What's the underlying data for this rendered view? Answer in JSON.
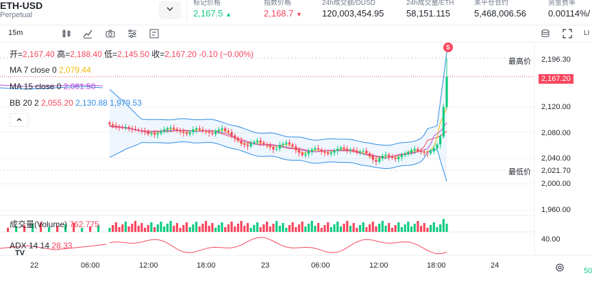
{
  "header": {
    "symbol": "ETH-USD",
    "subtitle": "Perpetual",
    "stats": [
      {
        "label": "标记价格",
        "value": "2,167.5",
        "arrow": "▲",
        "color": "green"
      },
      {
        "label": "指数价格",
        "value": "2,168.7",
        "arrow": "▼",
        "color": "red"
      },
      {
        "label": "24h成交额/DUSD",
        "value": "120,003,454.95",
        "color": "dark"
      },
      {
        "label": "24h成交量/ETH",
        "value": "58,151.115",
        "color": "dark"
      },
      {
        "label": "未平仓合约",
        "value": "5,468,006.56",
        "color": "dark"
      },
      {
        "label": "资金费率",
        "value": "0.00114%/",
        "color": "dark"
      }
    ]
  },
  "toolbar": {
    "timeframe": "15m",
    "right_cut": "LI"
  },
  "legend": {
    "ohlc": {
      "open_label": "开=",
      "open": "2,167.40",
      "high_label": "高=",
      "high": "2,188.40",
      "low_label": "低=",
      "low": "2,145.50",
      "close_label": "收=",
      "close": "2,167.20",
      "change": "-0.10 (−0.00%)"
    },
    "ma7": {
      "label": "MA 7 close 0",
      "value": "2,079.44"
    },
    "ma15": {
      "label": "MA 15 close 0",
      "value": "2,061.50"
    },
    "bb": {
      "label": "BB 20 2",
      "v1": "2,055.20",
      "v2": "2,130.88",
      "v3": "1,979.53"
    },
    "volume": {
      "label": "成交量(Volume)",
      "value": "762.775"
    },
    "adx": {
      "label": "ADX 14 14",
      "value": "28.33"
    },
    "signal": "S"
  },
  "price_axis": {
    "ticks": [
      "2,120.00",
      "2,080.00",
      "2,040.00",
      "2,000.00",
      "1,960.00"
    ],
    "top_value": "2,196.30",
    "current": "2,167.20",
    "low_value": "2,021.70",
    "high_tag": "最高价",
    "low_tag": "最低价",
    "adx_tick": "40.00",
    "right_cut": "50"
  },
  "time_axis": [
    "22",
    "06:00",
    "12:00",
    "18:00",
    "23",
    "06:00",
    "12:00",
    "18:00",
    "24"
  ],
  "colors": {
    "up": "#0ecb81",
    "down": "#f6465d",
    "bb": "#2e8ce6",
    "ma7": "#f0b90b",
    "ma15": "#b553d7",
    "cur": "#f6465d"
  },
  "chart_data": {
    "type": "candlestick",
    "timeframe": "15m",
    "ylim": [
      1960,
      2200
    ],
    "close_path": [
      2093,
      2091,
      2090,
      2089,
      2088,
      2089,
      2087,
      2086,
      2085,
      2084,
      2083,
      2082,
      2078,
      2079,
      2077,
      2079,
      2082,
      2085,
      2087,
      2088,
      2086,
      2084,
      2082,
      2080,
      2078,
      2081,
      2085,
      2087,
      2085,
      2083,
      2082,
      2080,
      2078,
      2083,
      2085,
      2087,
      2083,
      2081,
      2076,
      2071,
      2068,
      2063,
      2061,
      2059,
      2064,
      2066,
      2068,
      2065,
      2062,
      2060,
      2058,
      2054,
      2055,
      2061,
      2063,
      2065,
      2062,
      2059,
      2053,
      2049,
      2045,
      2047,
      2051,
      2054,
      2056,
      2054,
      2051,
      2049,
      2047,
      2049,
      2052,
      2055,
      2057,
      2055,
      2053,
      2054,
      2052,
      2050,
      2051,
      2052,
      2048,
      2044,
      2038,
      2035,
      2040,
      2044,
      2046,
      2043,
      2041,
      2039,
      2042,
      2045,
      2047,
      2050,
      2053,
      2055,
      2052,
      2050,
      2049,
      2048,
      2051,
      2056,
      2062,
      2074,
      2120,
      2167
    ]
  }
}
